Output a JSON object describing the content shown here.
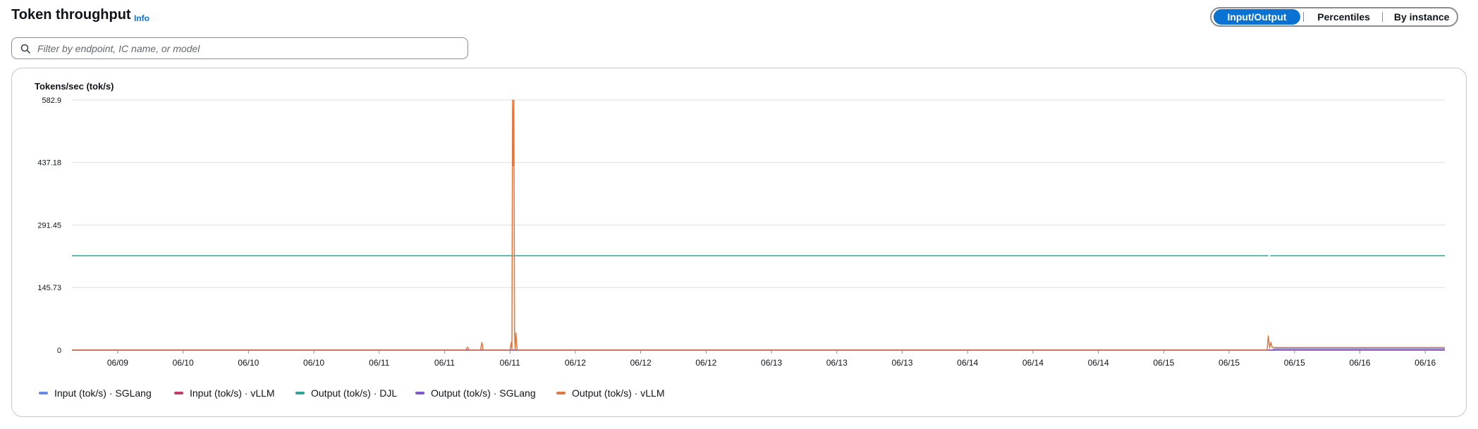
{
  "header": {
    "title": "Token throughput",
    "info_label": "Info"
  },
  "view_toggle": {
    "options": [
      "Input/Output",
      "Percentiles",
      "By instance"
    ],
    "selected": "Input/Output"
  },
  "filter": {
    "placeholder": "Filter by endpoint, IC name, or model",
    "value": ""
  },
  "colors": {
    "accent": "#0972d3",
    "input_sglang": "#688ae8",
    "input_vllm": "#c33d69",
    "output_djl": "#2ea597",
    "output_sglang": "#8456ce",
    "output_vllm": "#e07941"
  },
  "chart_data": {
    "type": "line",
    "ylabel": "Tokens/sec (tok/s)",
    "ylim": [
      0,
      582.9
    ],
    "y_ticks": [
      "582.9",
      "437.18",
      "291.45",
      "145.73",
      "0"
    ],
    "y_tick_values": [
      582.9,
      437.18,
      291.45,
      145.73,
      0
    ],
    "x_ticks": [
      "06/09",
      "06/10",
      "06/10",
      "06/10",
      "06/11",
      "06/11",
      "06/11",
      "06/12",
      "06/12",
      "06/12",
      "06/13",
      "06/13",
      "06/13",
      "06/14",
      "06/14",
      "06/14",
      "06/15",
      "06/15",
      "06/15",
      "06/16",
      "06/16"
    ],
    "x_range": [
      0,
      21
    ],
    "x_tick_positions": [
      0.7,
      1.7,
      2.7,
      3.7,
      4.7,
      5.7,
      6.7,
      7.7,
      8.7,
      9.7,
      10.7,
      11.7,
      12.7,
      13.7,
      14.7,
      15.7,
      16.7,
      17.7,
      18.7,
      19.7,
      20.7
    ],
    "legend_position": "bottom-left",
    "grid": true,
    "series": [
      {
        "name": "Input (tok/s) · SGLang",
        "color": "#688ae8",
        "x": [
          0,
          18.35,
          18.4,
          21
        ],
        "y": [
          0,
          0,
          3,
          3
        ]
      },
      {
        "name": "Input (tok/s) · vLLM",
        "color": "#c33d69",
        "x": [
          0,
          21
        ],
        "y": [
          0,
          0
        ]
      },
      {
        "name": "Output (tok/s) · DJL",
        "color": "#2ea597",
        "x": [
          0,
          18.3,
          null,
          18.33,
          21
        ],
        "y": [
          220,
          220,
          null,
          220,
          220
        ]
      },
      {
        "name": "Output (tok/s) · SGLang",
        "color": "#8456ce",
        "x": [
          0,
          21
        ],
        "y": [
          0,
          0
        ]
      },
      {
        "name": "Output (tok/s) · vLLM",
        "color": "#e07941",
        "x": [
          0,
          6.02,
          6.05,
          6.08,
          6.25,
          6.27,
          6.29,
          6.7,
          6.72,
          6.73,
          6.74,
          6.75,
          6.76,
          6.77,
          6.78,
          6.79,
          6.81,
          6.83,
          18.28,
          18.3,
          18.32,
          18.34,
          18.36,
          18.38,
          18.42,
          21
        ],
        "y": [
          0,
          0,
          7,
          0,
          0,
          18,
          0,
          0,
          18,
          0,
          582.9,
          430,
          582.9,
          40,
          0,
          40,
          0,
          0,
          0,
          33,
          5,
          18,
          6,
          6,
          6,
          6
        ]
      }
    ]
  }
}
